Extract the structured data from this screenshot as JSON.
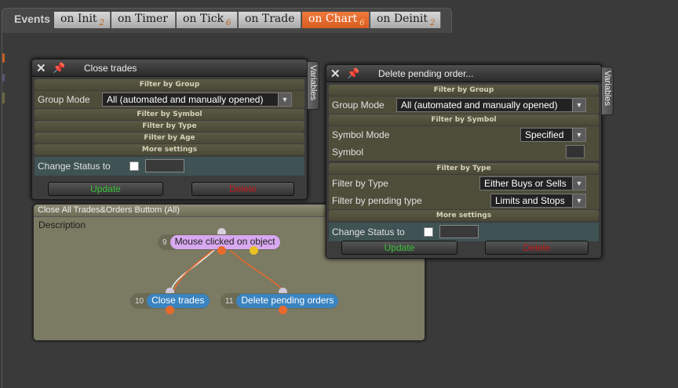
{
  "events_tabbar": {
    "label": "Events",
    "tabs": [
      {
        "label": "on Init",
        "badge": "2",
        "active": false
      },
      {
        "label": "on Timer",
        "badge": "",
        "active": false
      },
      {
        "label": "on Tick",
        "badge": "6",
        "active": false
      },
      {
        "label": "on Trade",
        "badge": "",
        "active": false
      },
      {
        "label": "on Chart",
        "badge": "6",
        "active": true
      },
      {
        "label": "on Deinit",
        "badge": "2",
        "active": false
      }
    ]
  },
  "flow": {
    "title": "Close All Trades&Orders Buttom (All)",
    "description": "Description",
    "nodes": [
      {
        "num": "9",
        "label": "Mouse clicked on object"
      },
      {
        "num": "10",
        "label": "Close trades"
      },
      {
        "num": "11",
        "label": "Delete pending orders"
      }
    ]
  },
  "close_dialog": {
    "title": "Close trades",
    "side_tab": "Variables",
    "filter_by_group": "Filter by Group",
    "group_mode_label": "Group Mode",
    "group_mode_value": "All (automated and manually opened)",
    "filter_by_symbol": "Filter by Symbol",
    "filter_by_type": "Filter by Type",
    "filter_by_age": "Filter by Age",
    "more_settings": "More settings",
    "change_status_label": "Change Status to",
    "update": "Update",
    "delete": "Delete"
  },
  "delete_dialog": {
    "title": "Delete pending order...",
    "side_tab": "Variables",
    "filter_by_group": "Filter by Group",
    "group_mode_label": "Group Mode",
    "group_mode_value": "All (automated and manually opened)",
    "filter_by_symbol": "Filter by Symbol",
    "symbol_mode_label": "Symbol Mode",
    "symbol_mode_value": "Specified",
    "symbol_label": "Symbol",
    "filter_by_type_section": "Filter by Type",
    "filter_by_type_label": "Filter by Type",
    "filter_by_type_value": "Either Buys or Sells",
    "filter_pending_label": "Filter by pending type",
    "filter_pending_value": "Limits and Stops",
    "more_settings": "More settings",
    "change_status_label": "Change Status to",
    "update": "Update",
    "delete": "Delete"
  },
  "colors": {
    "active_tab": "#e86a2c",
    "update_text": "#38c038",
    "delete_text": "#c01818",
    "node_purple": "#d8a8f0",
    "node_blue": "#3a84c0",
    "connector_orange": "#e86a2c",
    "connector_yellow": "#e8c020"
  }
}
